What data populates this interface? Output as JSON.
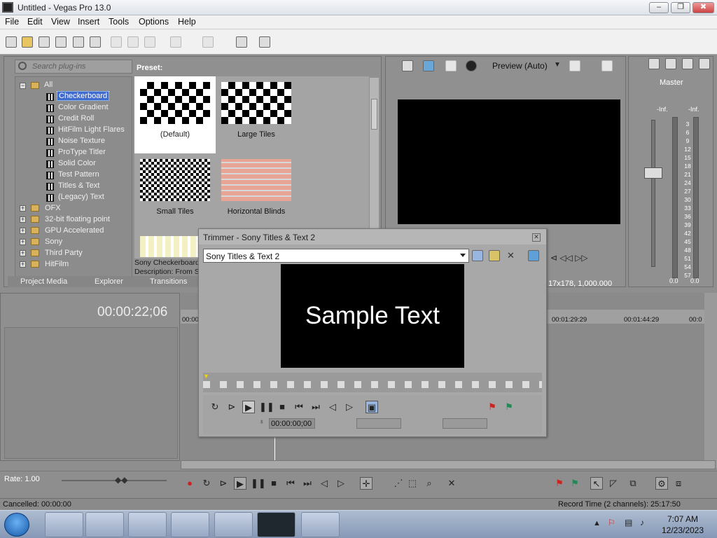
{
  "window": {
    "title": "Untitled - Vegas Pro 13.0",
    "minimize": "–",
    "maximize": "❐",
    "close": "✖"
  },
  "menu": [
    "File",
    "Edit",
    "View",
    "Insert",
    "Tools",
    "Options",
    "Help"
  ],
  "explorer": {
    "search_placeholder": "Search plug-ins",
    "tree_root": "All",
    "tree_children": [
      "Checkerboard",
      "Color Gradient",
      "Credit Roll",
      "HitFilm Light Flares",
      "Noise Texture",
      "ProType Titler",
      "Solid Color",
      "Test Pattern",
      "Titles & Text",
      "(Legacy) Text"
    ],
    "tree_folders": [
      "OFX",
      "32-bit floating point",
      "GPU Accelerated",
      "Sony",
      "Third Party",
      "HitFilm"
    ],
    "preset_label": "Preset:",
    "presets": [
      "(Default)",
      "Large Tiles",
      "Small Tiles",
      "Horizontal Blinds"
    ],
    "description_name": "Sony Checkerboard",
    "description_text": "Description: From S",
    "tabs": [
      "Project Media",
      "Explorer",
      "Transitions"
    ]
  },
  "preview": {
    "mode": "Preview (Auto)",
    "status": "17x178, 1,000.000"
  },
  "mixer": {
    "title": "Master",
    "inf_left": "-Inf.",
    "inf_right": "-Inf.",
    "scale": [
      "3",
      "6",
      "9",
      "12",
      "15",
      "18",
      "21",
      "24",
      "27",
      "30",
      "33",
      "36",
      "39",
      "42",
      "45",
      "48",
      "51",
      "54",
      "57"
    ],
    "peak_left": "0.0",
    "peak_right": "0.0"
  },
  "timeline": {
    "timecode": "00:00:22;06",
    "ruler": [
      "00:00",
      "00:01:29:29",
      "00:01:44:29",
      "00:0"
    ],
    "rate": "Rate: 1.00"
  },
  "trimmer": {
    "title": "Trimmer - Sony Titles & Text 2",
    "source": "Sony Titles & Text 2",
    "sample_text": "Sample Text",
    "timecode": "00:00:00;00"
  },
  "status": {
    "left": "Cancelled: 00:00:00",
    "right": "Record Time (2 channels): 25:17:50"
  },
  "taskbar": {
    "time": "7:07 AM",
    "date": "12/23/2023"
  }
}
